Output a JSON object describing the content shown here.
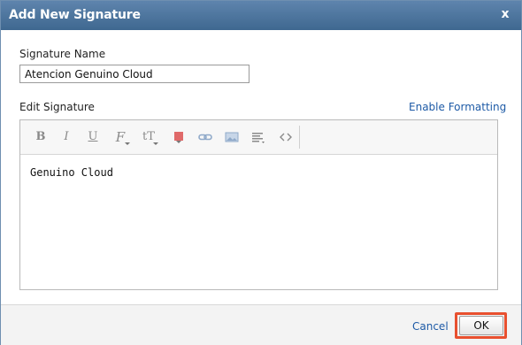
{
  "dialog": {
    "title": "Add New Signature",
    "close_label": "x"
  },
  "signature_name": {
    "label": "Signature Name",
    "value": "Atencion Genuino Cloud"
  },
  "edit_signature": {
    "label": "Edit Signature",
    "enable_formatting_label": "Enable Formatting",
    "content": "Genuino Cloud"
  },
  "toolbar": {
    "bold": "B",
    "italic": "I",
    "underline": "U",
    "font": "F",
    "font_size": "tT",
    "icons": [
      "bold-icon",
      "italic-icon",
      "underline-icon",
      "font-family-icon",
      "font-size-icon",
      "text-color-icon",
      "link-icon",
      "image-icon",
      "align-icon",
      "source-code-icon"
    ],
    "text_color": "#e06a6a"
  },
  "footer": {
    "cancel_label": "Cancel",
    "ok_label": "OK"
  },
  "colors": {
    "title_bar": "#4f77a1",
    "link": "#1d5aa6",
    "highlight": "#e8502f"
  }
}
